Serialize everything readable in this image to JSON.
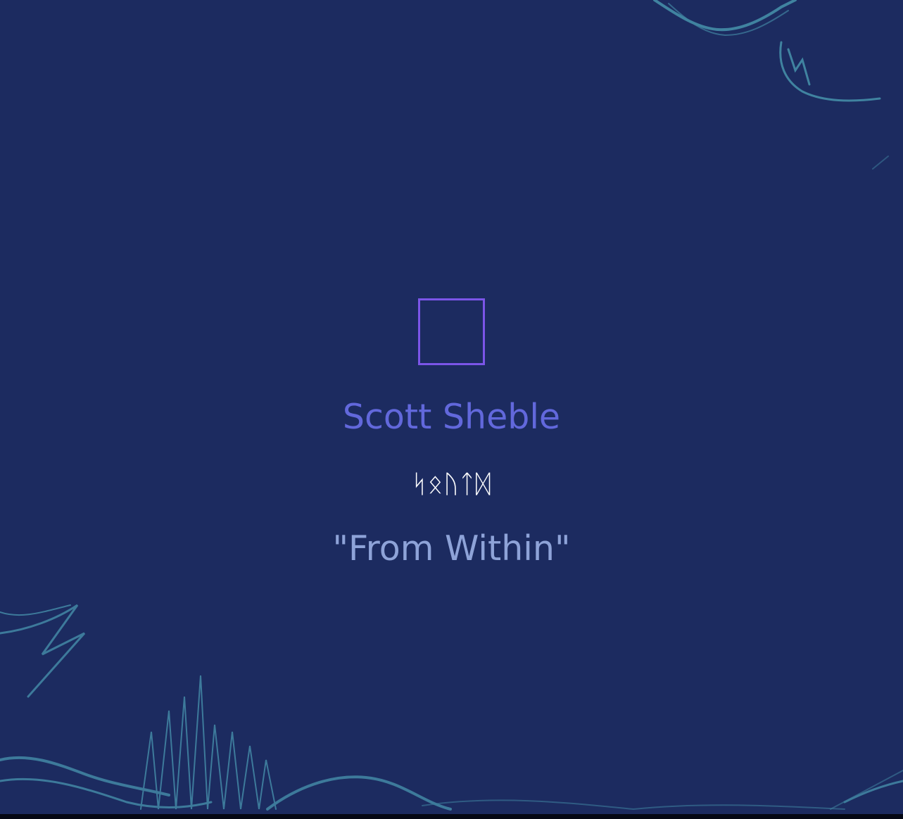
{
  "artist": "Scott Sheble",
  "runes": "ᛋᛟᚢᛏᛞ",
  "title": "\"From Within\"",
  "colors": {
    "background": "#1c2b60",
    "square": "#7b55e8",
    "artist": "#6268dc",
    "runes": "#ffffff",
    "title": "#8ea3d8",
    "waves": "#5ecbd6"
  },
  "icons": {
    "center": "square-outline-icon"
  }
}
